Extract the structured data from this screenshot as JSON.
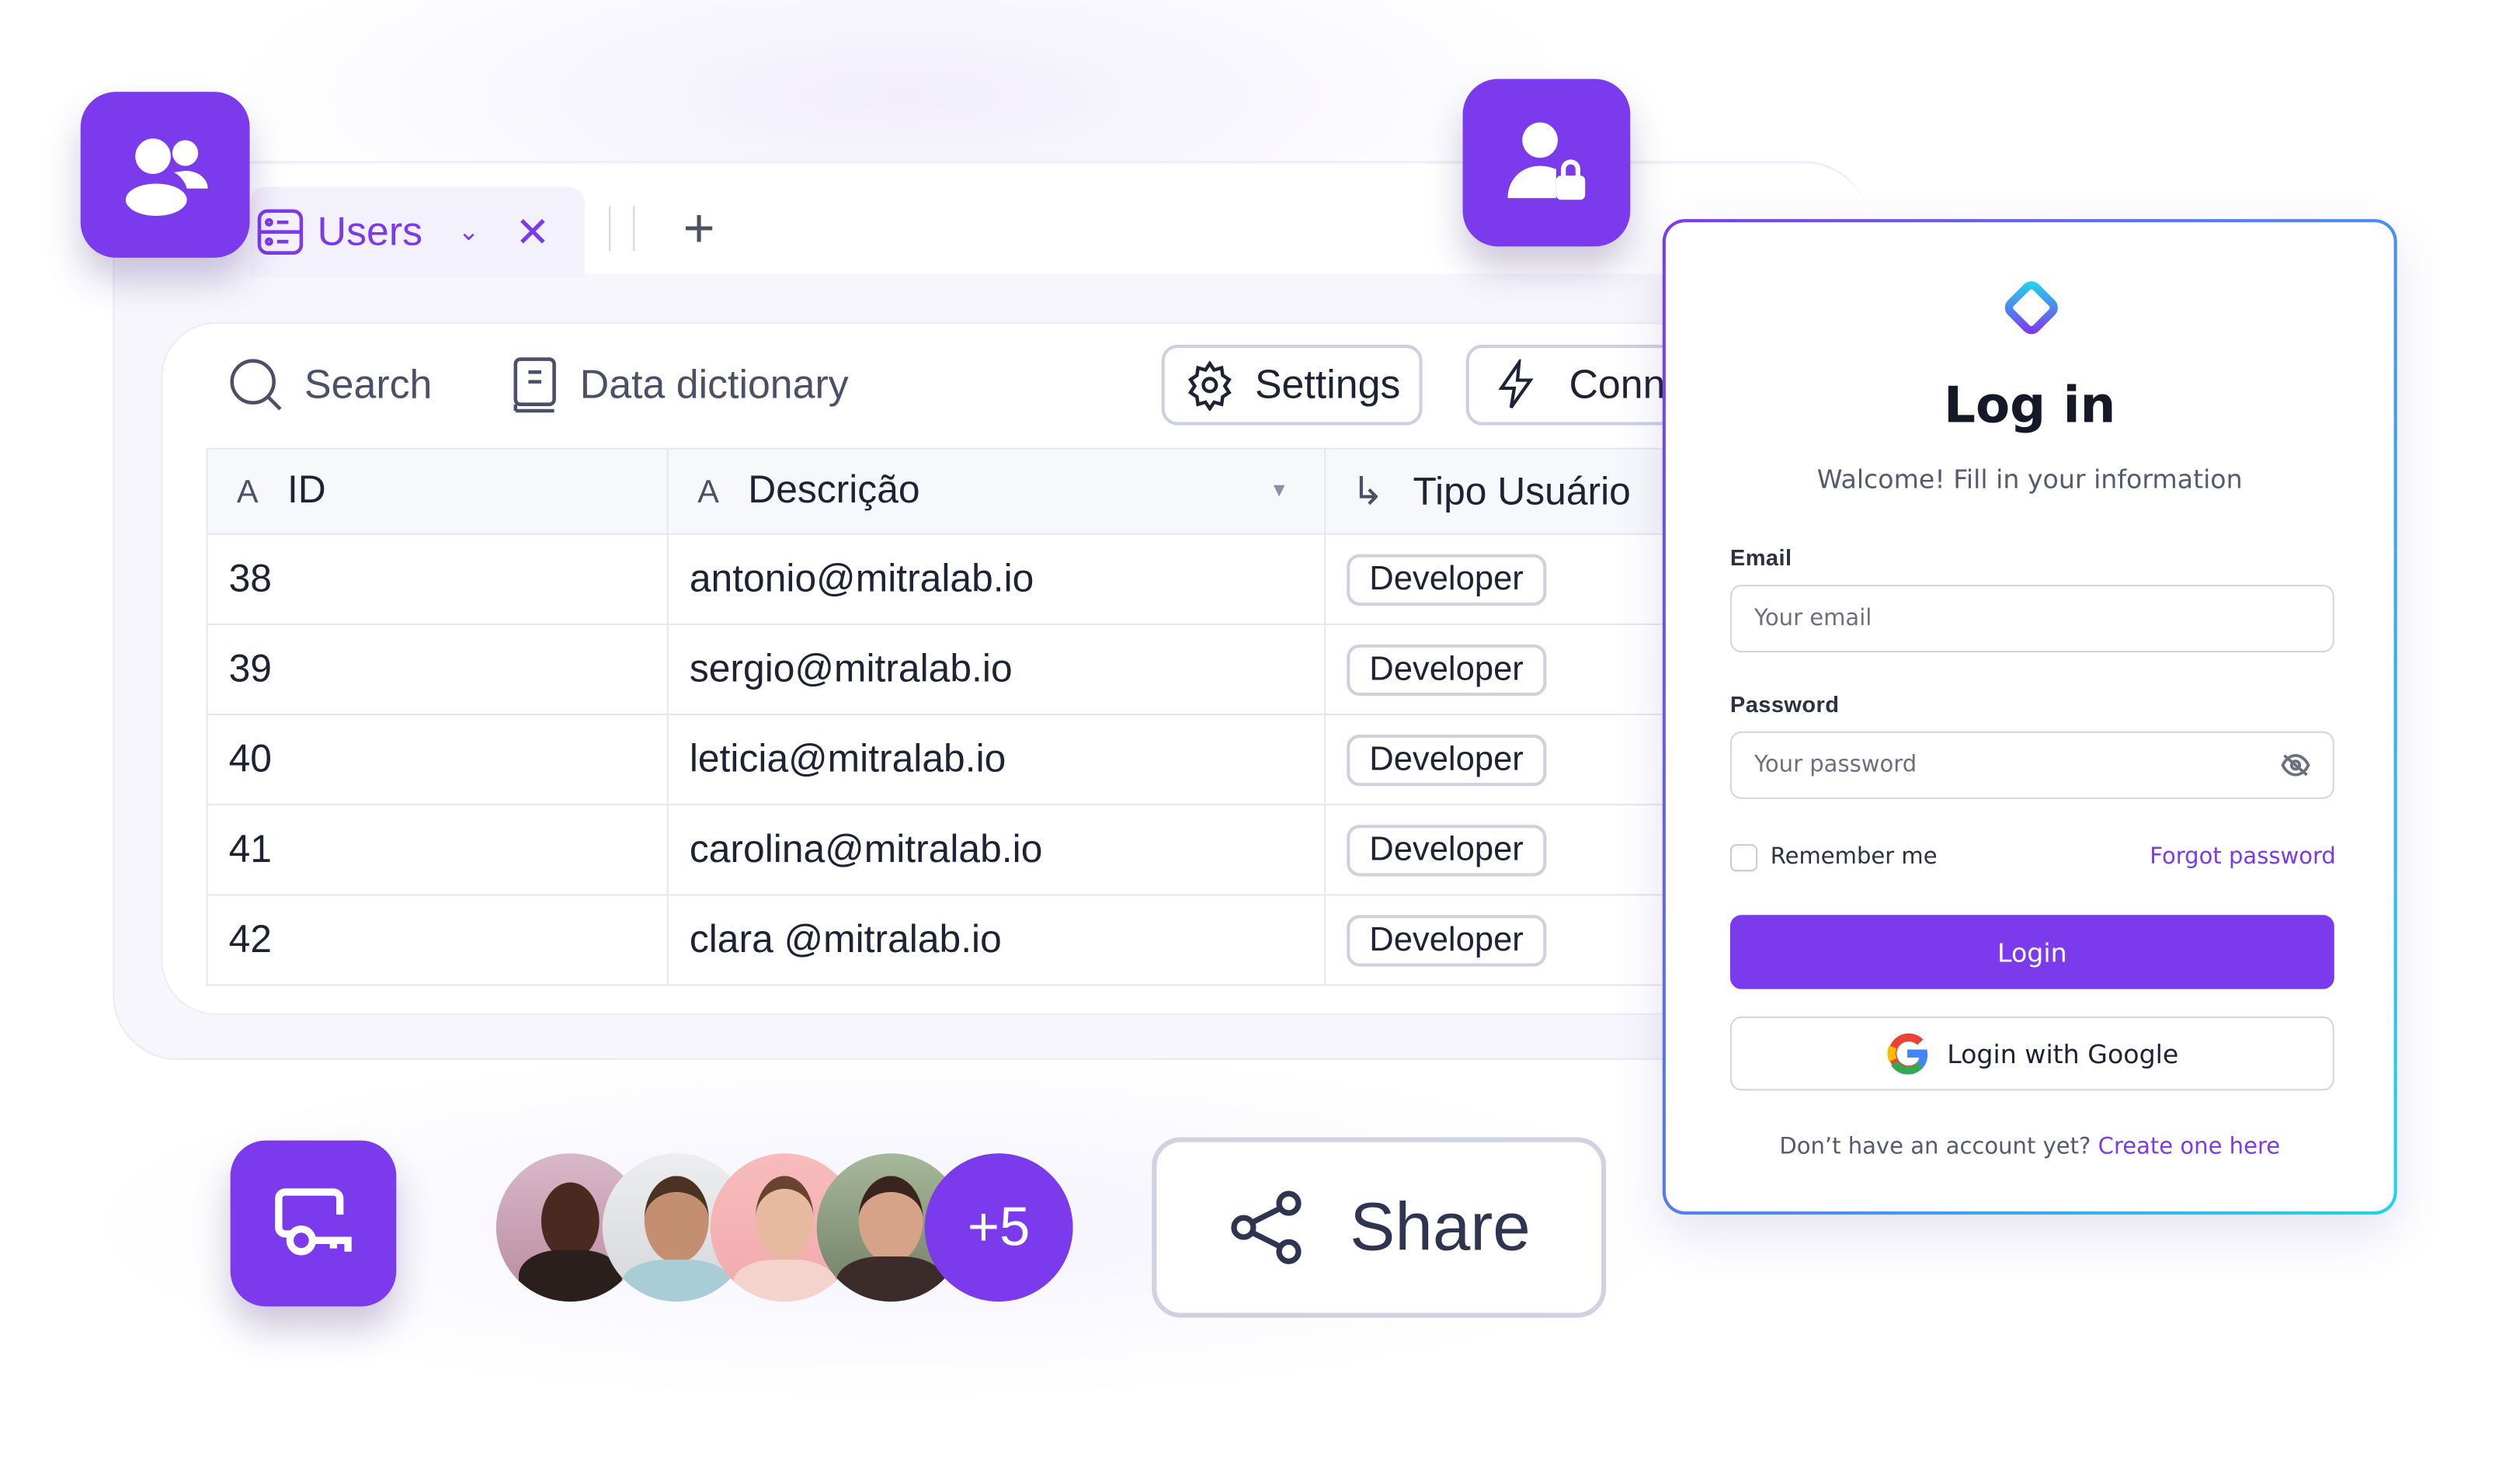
{
  "tab": {
    "label": "Users"
  },
  "toolbar": {
    "search": "Search",
    "data_dictionary": "Data dictionary",
    "settings": "Settings",
    "connect": "Conn"
  },
  "table": {
    "columns": [
      {
        "type": "A",
        "label": "ID"
      },
      {
        "type": "A",
        "label": "Descrição"
      },
      {
        "type": "↳",
        "label": "Tipo Usuário"
      }
    ],
    "rows": [
      {
        "id": "38",
        "desc": "antonio@mitralab.io",
        "type": "Developer"
      },
      {
        "id": "39",
        "desc": "sergio@mitralab.io",
        "type": "Developer"
      },
      {
        "id": "40",
        "desc": "leticia@mitralab.io",
        "type": "Developer"
      },
      {
        "id": "41",
        "desc": "carolina@mitralab.io",
        "type": "Developer"
      },
      {
        "id": "42",
        "desc": "clara @mitralab.io",
        "type": "Developer"
      }
    ]
  },
  "login": {
    "title": "Log in",
    "subtitle": "Walcome! Fill in your information",
    "email_label": "Email",
    "email_placeholder": "Your email",
    "password_label": "Password",
    "password_placeholder": "Your password",
    "remember": "Remember me",
    "forgot": "Forgot password",
    "login_button": "Login",
    "google_button": "Login with Google",
    "no_account": "Don’t have an account yet?",
    "create": "Create one here"
  },
  "avatars": {
    "more": "+5"
  },
  "share": {
    "label": "Share"
  },
  "colors": {
    "accent": "#7c3aed",
    "text": "#1e2235",
    "link": "#7c3aed"
  }
}
